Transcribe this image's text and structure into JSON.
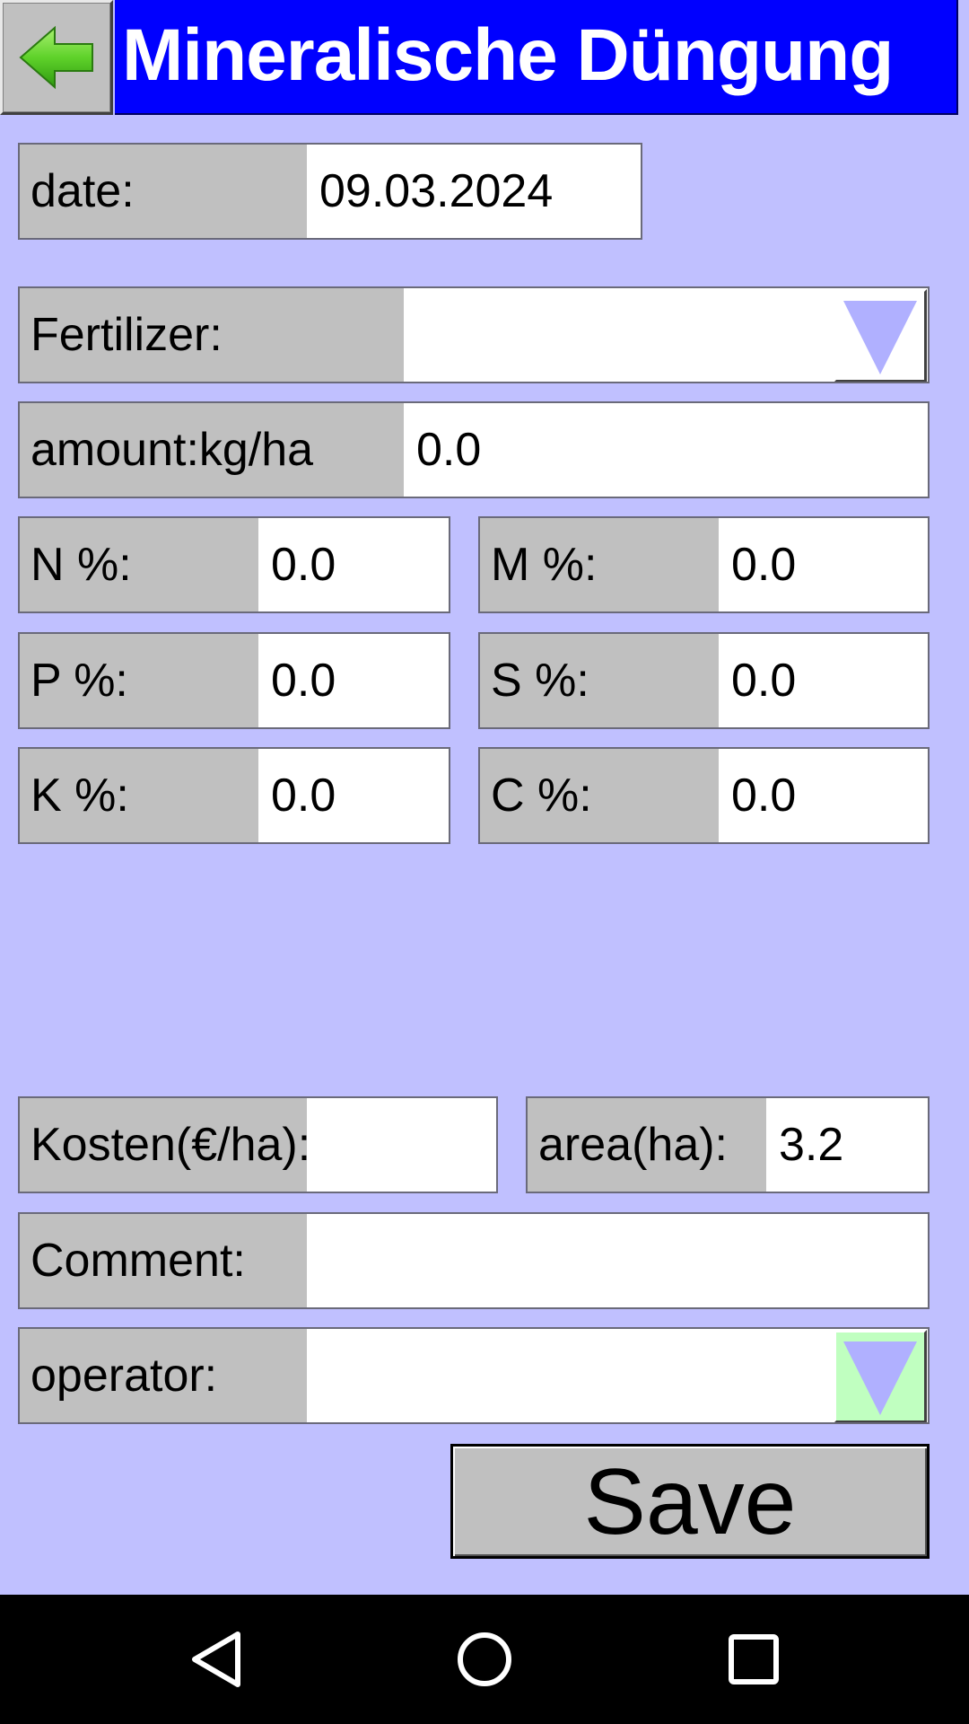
{
  "header": {
    "title": "Mineralische Düngung",
    "back_icon": "arrow-left-icon",
    "back_icon_color": "#5fd22a"
  },
  "form": {
    "date": {
      "label": "date:",
      "value": "09.03.2024"
    },
    "fertilizer": {
      "label": "Fertilizer:",
      "value": "",
      "dropdown_icon": "triangle-down-icon",
      "dropdown_bg": "#ffffff"
    },
    "amount": {
      "label": "amount:kg/ha",
      "value": "0.0"
    },
    "n_pct": {
      "label": "N %:",
      "value": "0.0"
    },
    "m_pct": {
      "label": "M %:",
      "value": "0.0"
    },
    "p_pct": {
      "label": "P %:",
      "value": "0.0"
    },
    "s_pct": {
      "label": "S %:",
      "value": "0.0"
    },
    "k_pct": {
      "label": "K %:",
      "value": "0.0"
    },
    "c_pct": {
      "label": "C %:",
      "value": "0.0"
    },
    "kosten": {
      "label": "Kosten(€/ha):",
      "value": ""
    },
    "area": {
      "label": "area(ha):",
      "value": "3.2"
    },
    "comment": {
      "label": "Comment:",
      "value": ""
    },
    "operator": {
      "label": "operator:",
      "value": "",
      "dropdown_icon": "triangle-down-icon",
      "dropdown_bg": "#c0ffc0"
    }
  },
  "save_label": "Save",
  "nav": {
    "back_icon": "nav-back-icon",
    "home_icon": "nav-home-icon",
    "recents_icon": "nav-recents-icon"
  },
  "colors": {
    "background": "#c0c0ff",
    "title_bar": "#0000ff",
    "label_bg": "#c0c0c0",
    "dropdown_triangle": "#b0b0ff"
  }
}
